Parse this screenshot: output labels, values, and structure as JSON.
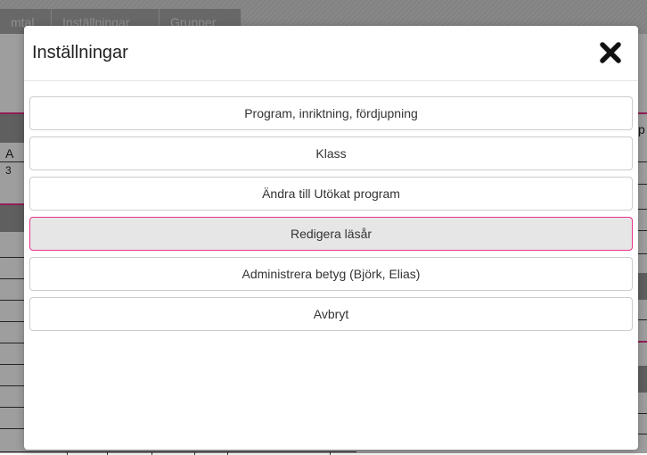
{
  "background": {
    "tabs": [
      "mtal",
      "Inställningar",
      "Grupper"
    ],
    "left_cells": [
      "A",
      "3"
    ],
    "right_cell": "p"
  },
  "modal": {
    "title": "Inställningar",
    "close_label": "✖",
    "options": [
      {
        "label": "Program, inriktning, fördjupning",
        "active": false
      },
      {
        "label": "Klass",
        "active": false
      },
      {
        "label": "Ändra till Utökat program",
        "active": false
      },
      {
        "label": "Redigera läsår",
        "active": true
      },
      {
        "label": "Administrera betyg (Björk, Elias)",
        "active": false
      },
      {
        "label": "Avbryt",
        "active": false
      }
    ]
  },
  "colors": {
    "accent": "#e8338a",
    "overlay": "rgba(0,0,0,0.38)"
  }
}
